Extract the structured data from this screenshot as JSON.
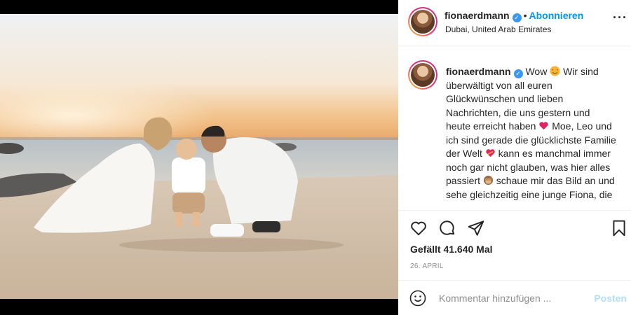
{
  "post": {
    "username": "fionaerdmann",
    "verified": true,
    "follow_label": "Abonnieren",
    "location": "Dubai, United Arab Emirates",
    "more_icon": "more-horizontal-icon"
  },
  "caption": {
    "username": "fionaerdmann",
    "part1": "Wow ",
    "part2": " Wir sind überwältigt von all euren Glückwünschen und lieben Nachrichten, die uns gestern und heute erreicht haben ",
    "part3": " Moe, Leo und ich sind gerade die glücklichste Familie der Welt ",
    "part4": " kann es manchmal immer noch gar nicht glauben, was hier alles passiert ",
    "part5": " schaue mir das Bild an und sehe gleichzeitig eine junge Fiona, die",
    "emojis": [
      "smiling-face-with-hearts",
      "red-heart",
      "heart-with-ribbon",
      "see-no-evil-monkey"
    ]
  },
  "actions": {
    "icons": [
      "heart-icon",
      "comment-icon",
      "share-icon",
      "bookmark-icon"
    ],
    "likes": "Gefällt 41.640 Mal",
    "date": "26. APRIL"
  },
  "comment": {
    "placeholder": "Kommentar hinzufügen ...",
    "post_label": "Posten"
  },
  "colors": {
    "accent": "#0095f6",
    "verified": "#3897f0",
    "post_disabled": "#b2dffc"
  }
}
